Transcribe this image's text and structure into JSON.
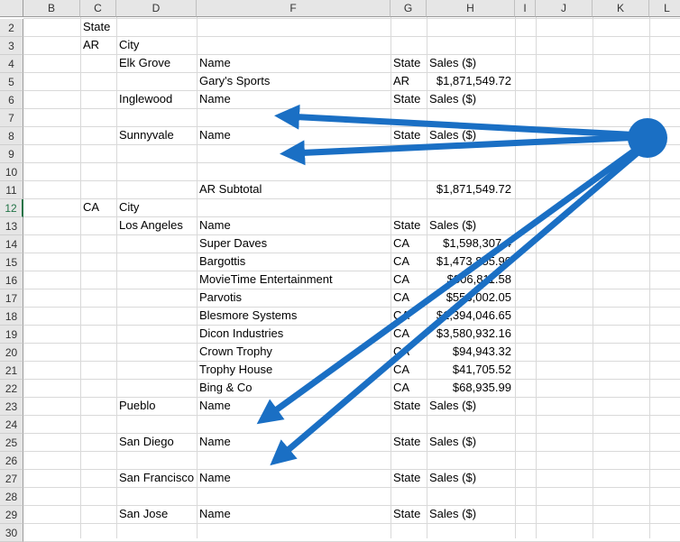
{
  "columns": [
    "B",
    "C",
    "D",
    "",
    "F",
    "G",
    "H",
    "I",
    "J",
    "K",
    "L"
  ],
  "row_numbers": [
    "2",
    "3",
    "4",
    "5",
    "6",
    "7",
    "8",
    "9",
    "10",
    "11",
    "12",
    "13",
    "14",
    "15",
    "16",
    "17",
    "18",
    "19",
    "20",
    "21",
    "22",
    "23",
    "24",
    "25",
    "26",
    "27",
    "28",
    "29",
    "30"
  ],
  "selected_row": "12",
  "rows": [
    {
      "C": "State",
      "D": "",
      "F": "",
      "G": "",
      "H": ""
    },
    {
      "C": "AR",
      "D": "City",
      "F": "",
      "G": "",
      "H": ""
    },
    {
      "C": "",
      "D": "Elk Grove",
      "F": "Name",
      "G": "State",
      "H": "Sales ($)"
    },
    {
      "C": "",
      "D": "",
      "F": "Gary's Sports",
      "G": "AR",
      "H": "$1,871,549.72"
    },
    {
      "C": "",
      "D": "Inglewood",
      "F": "Name",
      "G": "State",
      "H": "Sales ($)"
    },
    {
      "C": "",
      "D": "",
      "F": "",
      "G": "",
      "H": ""
    },
    {
      "C": "",
      "D": "Sunnyvale",
      "F": "Name",
      "G": "State",
      "H": "Sales ($)"
    },
    {
      "C": "",
      "D": "",
      "F": "",
      "G": "",
      "H": ""
    },
    {
      "C": "",
      "D": "",
      "F": "",
      "G": "",
      "H": ""
    },
    {
      "C": "",
      "D": "",
      "F": "AR Subtotal",
      "G": "",
      "H": "$1,871,549.72"
    },
    {
      "C": "CA",
      "D": "City",
      "F": "",
      "G": "",
      "H": ""
    },
    {
      "C": "",
      "D": "Los Angeles",
      "F": "Name",
      "G": "State",
      "H": "Sales ($)"
    },
    {
      "C": "",
      "D": "",
      "F": "Super Daves",
      "G": "CA",
      "H": "$1,598,307.4"
    },
    {
      "C": "",
      "D": "",
      "F": "Bargottis",
      "G": "CA",
      "H": "$1,473,855.90"
    },
    {
      "C": "",
      "D": "",
      "F": "MovieTime Entertainment",
      "G": "CA",
      "H": "$806,811.58"
    },
    {
      "C": "",
      "D": "",
      "F": "Parvotis",
      "G": "CA",
      "H": "$556,002.05"
    },
    {
      "C": "",
      "D": "",
      "F": "Blesmore Systems",
      "G": "CA",
      "H": "$1,394,046.65"
    },
    {
      "C": "",
      "D": "",
      "F": "Dicon Industries",
      "G": "CA",
      "H": "$3,580,932.16"
    },
    {
      "C": "",
      "D": "",
      "F": "Crown Trophy",
      "G": "CA",
      "H": "$94,943.32"
    },
    {
      "C": "",
      "D": "",
      "F": "Trophy House",
      "G": "CA",
      "H": "$41,705.52"
    },
    {
      "C": "",
      "D": "",
      "F": "Bing & Co",
      "G": "CA",
      "H": "$68,935.99"
    },
    {
      "C": "",
      "D": "Pueblo",
      "F": "Name",
      "G": "State",
      "H": "Sales ($)"
    },
    {
      "C": "",
      "D": "",
      "F": "",
      "G": "",
      "H": ""
    },
    {
      "C": "",
      "D": "San Diego",
      "F": "Name",
      "G": "State",
      "H": "Sales ($)"
    },
    {
      "C": "",
      "D": "",
      "F": "",
      "G": "",
      "H": ""
    },
    {
      "C": "",
      "D": "San Francisco",
      "F": "Name",
      "G": "State",
      "H": "Sales ($)"
    },
    {
      "C": "",
      "D": "",
      "F": "",
      "G": "",
      "H": ""
    },
    {
      "C": "",
      "D": "San Jose",
      "F": "Name",
      "G": "State",
      "H": "Sales ($)"
    },
    {
      "C": "",
      "D": "",
      "F": "",
      "G": "",
      "H": ""
    }
  ],
  "annotation": {
    "arrow_color": "#1a6fc4",
    "shape": "circle-with-four-arrows"
  }
}
